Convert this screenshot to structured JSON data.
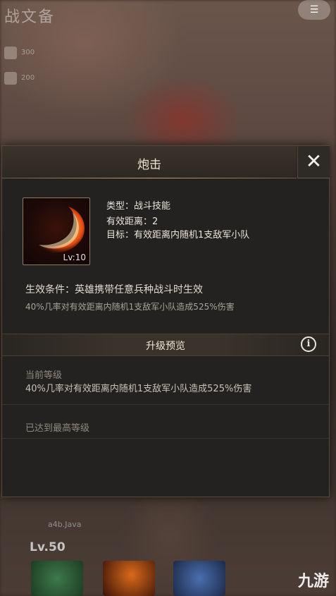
{
  "background": {
    "title": "战文备",
    "top_button": "☰",
    "chip1": "300",
    "chip2": "200",
    "level": "Lv.50",
    "hero_name": "a4b.Java",
    "watermark": "九游"
  },
  "dialog": {
    "title": "炮击",
    "close": "✕",
    "skill": {
      "level": "Lv:10",
      "type": "类型：战斗技能",
      "range": "有效距离：2",
      "target": "目标：有效距离内随机1支敌军小队"
    },
    "condition": "生效条件：英雄携带任意兵种战斗时生效",
    "description": "40%几率对有效距离内随机1支敌军小队造成525%伤害",
    "upgrade": {
      "section_title": "升级预览",
      "info_icon": "i",
      "current_label": "当前等级",
      "current_desc": "40%几率对有效距离内随机1支敌军小队造成525%伤害",
      "max_label": "已达到最高等级"
    }
  },
  "colors": {
    "accent_gold": "#c8a876",
    "panel": "#242220",
    "skill_flame": "#ff7a1a"
  }
}
